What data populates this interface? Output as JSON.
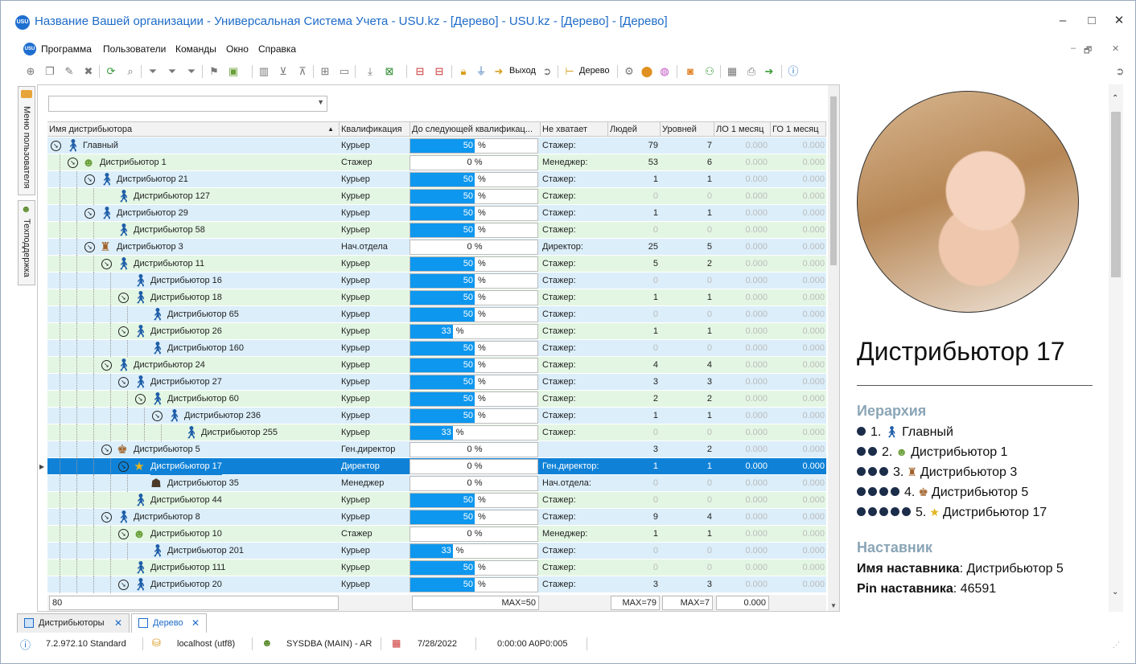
{
  "window": {
    "title": "Название Вашей организации - Универсальная Система Учета - USU.kz - [Дерево] - USU.kz - [Дерево] - [Дерево]",
    "logo": "USU",
    "minimize": "–",
    "maximize": "□",
    "close": "✕"
  },
  "menu": {
    "items": [
      "Программа",
      "Пользователи",
      "Команды",
      "Окно",
      "Справка"
    ],
    "mdi_min": "–",
    "mdi_restore": "🗗",
    "mdi_close": "✕"
  },
  "toolbar": {
    "exit_label": "Выход",
    "tree_label": "Дерево"
  },
  "side_tabs": [
    "Меню пользователя",
    "Техподдержка"
  ],
  "grid": {
    "filter_value": "",
    "columns": [
      "Имя дистрибьютора",
      "Квалификация",
      "До следующей квалификац...",
      "Не хватает",
      "Людей",
      "Уровней",
      "ЛО 1 месяц",
      "ГО 1 месяц"
    ],
    "rows": [
      {
        "level": 0,
        "exp": true,
        "icon": "person",
        "name": "Главный",
        "qual": "Курьер",
        "pct": 50,
        "need": "Стажер:",
        "people": "79",
        "levels": "7",
        "lo": "0.000",
        "go": "0.000",
        "bg": "b"
      },
      {
        "level": 1,
        "exp": true,
        "icon": "trainee",
        "name": "Дистрибьютор 1",
        "qual": "Стажер",
        "pct": 0,
        "need": "Менеджер:",
        "people": "53",
        "levels": "6",
        "lo": "0.000",
        "go": "0.000",
        "bg": "g"
      },
      {
        "level": 2,
        "exp": true,
        "icon": "person",
        "name": "Дистрибьютор 21",
        "qual": "Курьер",
        "pct": 50,
        "need": "Стажер:",
        "people": "1",
        "levels": "1",
        "lo": "0.000",
        "go": "0.000",
        "bg": "b"
      },
      {
        "level": 3,
        "exp": false,
        "icon": "person",
        "name": "Дистрибьютор 127",
        "qual": "Курьер",
        "pct": 50,
        "need": "Стажер:",
        "people": "0",
        "levels": "0",
        "lo": "0.000",
        "go": "0.000",
        "bg": "g"
      },
      {
        "level": 2,
        "exp": true,
        "icon": "person",
        "name": "Дистрибьютор 29",
        "qual": "Курьер",
        "pct": 50,
        "need": "Стажер:",
        "people": "1",
        "levels": "1",
        "lo": "0.000",
        "go": "0.000",
        "bg": "b"
      },
      {
        "level": 3,
        "exp": false,
        "icon": "person",
        "name": "Дистрибьютор 58",
        "qual": "Курьер",
        "pct": 50,
        "need": "Стажер:",
        "people": "0",
        "levels": "0",
        "lo": "0.000",
        "go": "0.000",
        "bg": "g"
      },
      {
        "level": 2,
        "exp": true,
        "icon": "head",
        "name": "Дистрибьютор 3",
        "qual": "Нач.отдела",
        "pct": 0,
        "need": "Директор:",
        "people": "25",
        "levels": "5",
        "lo": "0.000",
        "go": "0.000",
        "bg": "b"
      },
      {
        "level": 3,
        "exp": true,
        "icon": "person",
        "name": "Дистрибьютор 11",
        "qual": "Курьер",
        "pct": 50,
        "need": "Стажер:",
        "people": "5",
        "levels": "2",
        "lo": "0.000",
        "go": "0.000",
        "bg": "g"
      },
      {
        "level": 4,
        "exp": false,
        "icon": "person",
        "name": "Дистрибьютор 16",
        "qual": "Курьер",
        "pct": 50,
        "need": "Стажер:",
        "people": "0",
        "levels": "0",
        "lo": "0.000",
        "go": "0.000",
        "bg": "b"
      },
      {
        "level": 4,
        "exp": true,
        "icon": "person",
        "name": "Дистрибьютор 18",
        "qual": "Курьер",
        "pct": 50,
        "need": "Стажер:",
        "people": "1",
        "levels": "1",
        "lo": "0.000",
        "go": "0.000",
        "bg": "g"
      },
      {
        "level": 5,
        "exp": false,
        "icon": "person",
        "name": "Дистрибьютор 65",
        "qual": "Курьер",
        "pct": 50,
        "need": "Стажер:",
        "people": "0",
        "levels": "0",
        "lo": "0.000",
        "go": "0.000",
        "bg": "b"
      },
      {
        "level": 4,
        "exp": true,
        "icon": "person",
        "name": "Дистрибьютор 26",
        "qual": "Курьер",
        "pct": 33,
        "need": "Стажер:",
        "people": "1",
        "levels": "1",
        "lo": "0.000",
        "go": "0.000",
        "bg": "g"
      },
      {
        "level": 5,
        "exp": false,
        "icon": "person",
        "name": "Дистрибьютор 160",
        "qual": "Курьер",
        "pct": 50,
        "need": "Стажер:",
        "people": "0",
        "levels": "0",
        "lo": "0.000",
        "go": "0.000",
        "bg": "b"
      },
      {
        "level": 3,
        "exp": true,
        "icon": "person",
        "name": "Дистрибьютор 24",
        "qual": "Курьер",
        "pct": 50,
        "need": "Стажер:",
        "people": "4",
        "levels": "4",
        "lo": "0.000",
        "go": "0.000",
        "bg": "g"
      },
      {
        "level": 4,
        "exp": true,
        "icon": "person",
        "name": "Дистрибьютор 27",
        "qual": "Курьер",
        "pct": 50,
        "need": "Стажер:",
        "people": "3",
        "levels": "3",
        "lo": "0.000",
        "go": "0.000",
        "bg": "b"
      },
      {
        "level": 5,
        "exp": true,
        "icon": "person",
        "name": "Дистрибьютор 60",
        "qual": "Курьер",
        "pct": 50,
        "need": "Стажер:",
        "people": "2",
        "levels": "2",
        "lo": "0.000",
        "go": "0.000",
        "bg": "g"
      },
      {
        "level": 6,
        "exp": true,
        "icon": "person",
        "name": "Дистрибьютор 236",
        "qual": "Курьер",
        "pct": 50,
        "need": "Стажер:",
        "people": "1",
        "levels": "1",
        "lo": "0.000",
        "go": "0.000",
        "bg": "b"
      },
      {
        "level": 7,
        "exp": false,
        "icon": "person",
        "name": "Дистрибьютор 255",
        "qual": "Курьер",
        "pct": 33,
        "need": "Стажер:",
        "people": "0",
        "levels": "0",
        "lo": "0.000",
        "go": "0.000",
        "bg": "g"
      },
      {
        "level": 3,
        "exp": true,
        "icon": "gendir",
        "name": "Дистрибьютор 5",
        "qual": "Ген.директор",
        "pct": 0,
        "need": "",
        "people": "3",
        "levels": "2",
        "lo": "0.000",
        "go": "0.000",
        "bg": "b"
      },
      {
        "level": 4,
        "exp": true,
        "icon": "star",
        "name": "Дистрибьютор 17",
        "qual": "Директор",
        "pct": 0,
        "need": "Ген.директор:",
        "people": "1",
        "levels": "1",
        "lo": "0.000",
        "go": "0.000",
        "bg": "sel"
      },
      {
        "level": 5,
        "exp": false,
        "icon": "manager",
        "name": "Дистрибьютор 35",
        "qual": "Менеджер",
        "pct": 0,
        "need": "Нач.отдела:",
        "people": "0",
        "levels": "0",
        "lo": "0.000",
        "go": "0.000",
        "bg": "b"
      },
      {
        "level": 4,
        "exp": false,
        "icon": "person",
        "name": "Дистрибьютор 44",
        "qual": "Курьер",
        "pct": 50,
        "need": "Стажер:",
        "people": "0",
        "levels": "0",
        "lo": "0.000",
        "go": "0.000",
        "bg": "g"
      },
      {
        "level": 3,
        "exp": true,
        "icon": "person",
        "name": "Дистрибьютор 8",
        "qual": "Курьер",
        "pct": 50,
        "need": "Стажер:",
        "people": "9",
        "levels": "4",
        "lo": "0.000",
        "go": "0.000",
        "bg": "b"
      },
      {
        "level": 4,
        "exp": true,
        "icon": "trainee",
        "name": "Дистрибьютор 10",
        "qual": "Стажер",
        "pct": 0,
        "need": "Менеджер:",
        "people": "1",
        "levels": "1",
        "lo": "0.000",
        "go": "0.000",
        "bg": "g"
      },
      {
        "level": 5,
        "exp": false,
        "icon": "person",
        "name": "Дистрибьютор 201",
        "qual": "Курьер",
        "pct": 33,
        "need": "Стажер:",
        "people": "0",
        "levels": "0",
        "lo": "0.000",
        "go": "0.000",
        "bg": "b"
      },
      {
        "level": 4,
        "exp": false,
        "icon": "person",
        "name": "Дистрибьютор 111",
        "qual": "Курьер",
        "pct": 50,
        "need": "Стажер:",
        "people": "0",
        "levels": "0",
        "lo": "0.000",
        "go": "0.000",
        "bg": "g"
      },
      {
        "level": 4,
        "exp": true,
        "icon": "person",
        "name": "Дистрибьютор 20",
        "qual": "Курьер",
        "pct": 50,
        "need": "Стажер:",
        "people": "3",
        "levels": "3",
        "lo": "0.000",
        "go": "0.000",
        "bg": "b"
      }
    ],
    "footer": {
      "count": "80",
      "pct_max": "MAX=50",
      "people_max": "MAX=79",
      "levels_max": "MAX=7",
      "lo_sum": "0.000"
    }
  },
  "detail": {
    "name": "Дистрибьютор 17",
    "hierarchy_title": "Иерархия",
    "hierarchy": [
      {
        "num": "1.",
        "icon": "person",
        "name": "Главный"
      },
      {
        "num": "2.",
        "icon": "trainee",
        "name": "Дистрибьютор 1"
      },
      {
        "num": "3.",
        "icon": "head",
        "name": "Дистрибьютор 3"
      },
      {
        "num": "4.",
        "icon": "gendir",
        "name": "Дистрибьютор 5"
      },
      {
        "num": "5.",
        "icon": "star",
        "name": "Дистрибьютор 17"
      }
    ],
    "mentor_title": "Наставник",
    "mentor_name_label": "Имя наставника",
    "mentor_name": "Дистрибьютор 5",
    "mentor_pin_label": "Pin наставника",
    "mentor_pin": "46591"
  },
  "doc_tabs": [
    {
      "label": "Дистрибьюторы",
      "active": false
    },
    {
      "label": "Дерево",
      "active": true
    }
  ],
  "status": {
    "version": "7.2.972.10 Standard",
    "server": "localhost (utf8)",
    "user": "SYSDBA (MAIN) - AR",
    "date": "7/28/2022",
    "timer": "0:00:00 A0P0:005"
  },
  "colors": {
    "accent": "#1d6bc8",
    "row_blue": "#dbeefa",
    "row_green": "#e3f6e3",
    "selected": "#0f82d8",
    "progress": "#0d97ee"
  }
}
